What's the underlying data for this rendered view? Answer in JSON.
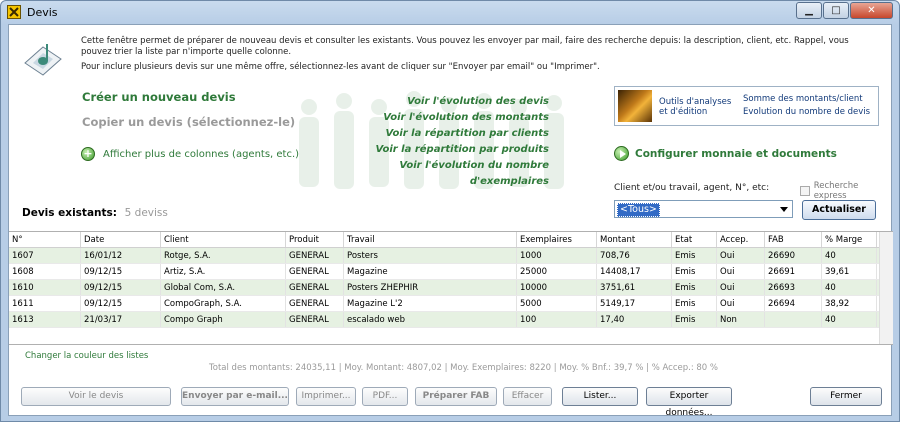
{
  "window": {
    "title": "Devis"
  },
  "intro": {
    "line1": "Cette fenêtre permet de préparer de nouveau devis et consulter les existants. Vous pouvez les envoyer par mail, faire des recherche depuis: la description, client, etc. Rappel, vous pouvez trier la liste par n'importe quelle colonne.",
    "line2": "Pour inclure plusieurs devis sur une même offre, sélectionnez-les avant de cliquer sur \"Envoyer par email\" ou \"Imprimer\"."
  },
  "actions": {
    "create": "Créer un nouveau devis",
    "copy": "Copier un devis (sélectionnez-le)",
    "more_columns": "Afficher plus de colonnes (agents, etc.)"
  },
  "center_links": [
    "Voir l'évolution des devis",
    "Voir l'évolution des montants",
    "Voir la répartition par clients",
    "Voir la répartition par produits",
    "Voir l'évolution du nombre d'exemplaires"
  ],
  "tools": {
    "label": "Outils d'analyses et d'édition",
    "links": [
      "Somme des montants/client",
      "Evolution du nombre de devis"
    ]
  },
  "config": {
    "label": "Configurer monnaie et documents"
  },
  "filter": {
    "label": "Client et/ou travail, agent, N°, etc:",
    "selected": "<Tous>",
    "express_label": "Recherche express",
    "refresh": "Actualiser"
  },
  "existing": {
    "label": "Devis existants:",
    "count": "5 deviss"
  },
  "table": {
    "headers": [
      "N°",
      "Date",
      "Client",
      "Produit",
      "Travail",
      "Exemplaires",
      "Montant",
      "Etat",
      "Accep.",
      "FAB",
      "% Marge"
    ],
    "rows": [
      [
        "1607",
        "16/01/12",
        "Rotge, S.A.",
        "GENERAL",
        "Posters",
        "1000",
        "708,76",
        "Emis",
        "Oui",
        "26690",
        "40"
      ],
      [
        "1608",
        "09/12/15",
        "Artiz, S.A.",
        "GENERAL",
        "Magazine",
        "25000",
        "14408,17",
        "Emis",
        "Oui",
        "26691",
        "39,61"
      ],
      [
        "1610",
        "09/12/15",
        "Global Com, S.A.",
        "GENERAL",
        "Posters ZHEPHIR",
        "10000",
        "3751,61",
        "Emis",
        "Oui",
        "26693",
        "40"
      ],
      [
        "1611",
        "09/12/15",
        "CompoGraph, S.A.",
        "GENERAL",
        "Magazine L'2",
        "5000",
        "5149,17",
        "Emis",
        "Oui",
        "26694",
        "38,92"
      ],
      [
        "1613",
        "21/03/17",
        "Compo Graph",
        "GENERAL",
        "escalado web",
        "100",
        "17,40",
        "Emis",
        "Non",
        "",
        "40"
      ]
    ]
  },
  "footer": {
    "change_color": "Changer la couleur des listes",
    "totals": "Total des montants: 24035,11  |  Moy. Montant: 4807,02  |  Moy. Exemplaires: 8220  |  Moy. % Bnf.: 39,7 %  |  % Accep.: 80 %"
  },
  "buttons": {
    "view": "Voir le devis",
    "email": "Envoyer par e-mail...",
    "print": "Imprimer...",
    "pdf": "PDF...",
    "fab": "Préparer FAB",
    "delete": "Effacer",
    "list": "Lister...",
    "export": "Exporter données...",
    "close": "Fermer"
  }
}
